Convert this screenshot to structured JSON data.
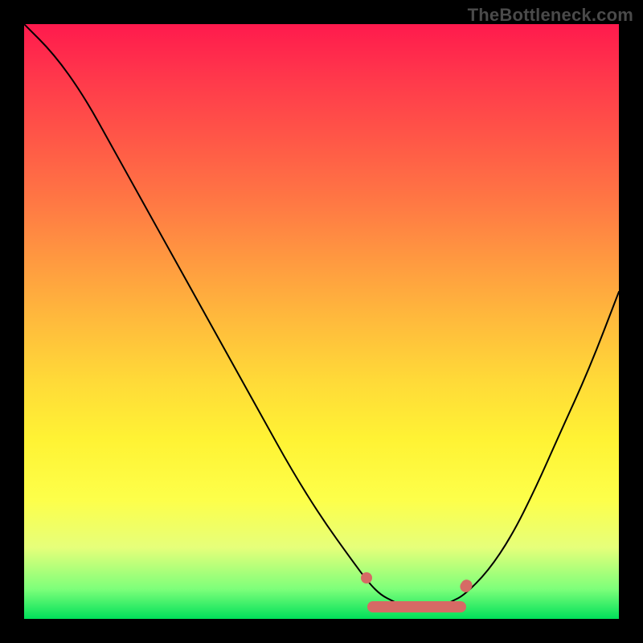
{
  "watermark": "TheBottleneck.com",
  "chart_data": {
    "type": "line",
    "title": "",
    "xlabel": "",
    "ylabel": "",
    "xlim": [
      0,
      100
    ],
    "ylim": [
      0,
      100
    ],
    "grid": false,
    "legend": false,
    "series": [
      {
        "name": "curve",
        "x": [
          0,
          5,
          10,
          15,
          20,
          25,
          30,
          35,
          40,
          45,
          50,
          55,
          58,
          60,
          62,
          64,
          66,
          68,
          70,
          72,
          74,
          78,
          82,
          86,
          90,
          95,
          100
        ],
        "y": [
          100,
          95,
          88,
          79,
          70,
          61,
          52,
          43,
          34,
          25,
          17,
          10,
          6,
          4,
          3,
          2,
          2,
          2,
          2,
          3,
          4,
          8,
          14,
          22,
          31,
          42,
          55
        ]
      }
    ],
    "highlight_range_x": [
      58,
      74
    ],
    "background_gradient": {
      "top": "#ff1a4d",
      "bottom": "#00e05a"
    }
  }
}
